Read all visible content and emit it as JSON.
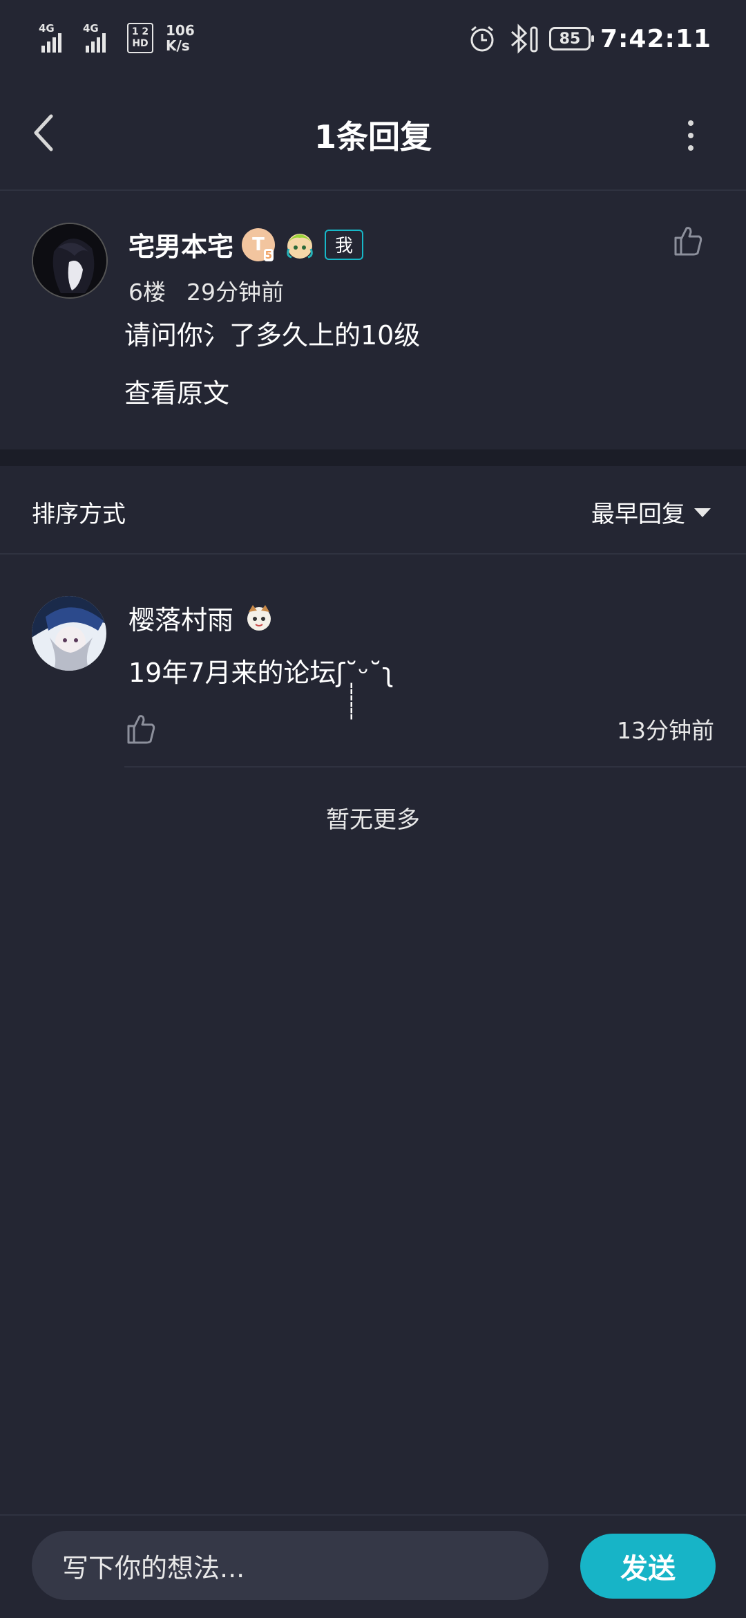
{
  "status_bar": {
    "net1": "4G",
    "net2": "4G",
    "hd_top": "1 2",
    "hd_bottom": "HD",
    "speed_value": "106",
    "speed_unit": "K/s",
    "battery": "85",
    "time": "7:42:11"
  },
  "header": {
    "title": "1条回复"
  },
  "post": {
    "username": "宅男本宅",
    "level_badge": "T",
    "level_sub": "5",
    "me_badge": "我",
    "floor": "6楼",
    "time": "29分钟前",
    "content": "请问你氵了多久上的10级",
    "view_original": "查看原文"
  },
  "sort": {
    "label": "排序方式",
    "value": "最早回复"
  },
  "replies": [
    {
      "username": "樱落村雨",
      "content": "19年7月来的论坛ʃ˘̩̩̩̩̩̩ᵕ˘ʅ",
      "time": "13分钟前"
    }
  ],
  "footer_text": "暂无更多",
  "bottom": {
    "placeholder": "写下你的想法...",
    "send_label": "发送"
  },
  "colors": {
    "background": "#242633",
    "accent": "#17b4c7",
    "input_bg": "#353847"
  },
  "icons": [
    "back-arrow-icon",
    "more-vertical-icon",
    "thumb-up-icon",
    "chevron-down-icon",
    "alarm-icon",
    "bluetooth-icon"
  ]
}
